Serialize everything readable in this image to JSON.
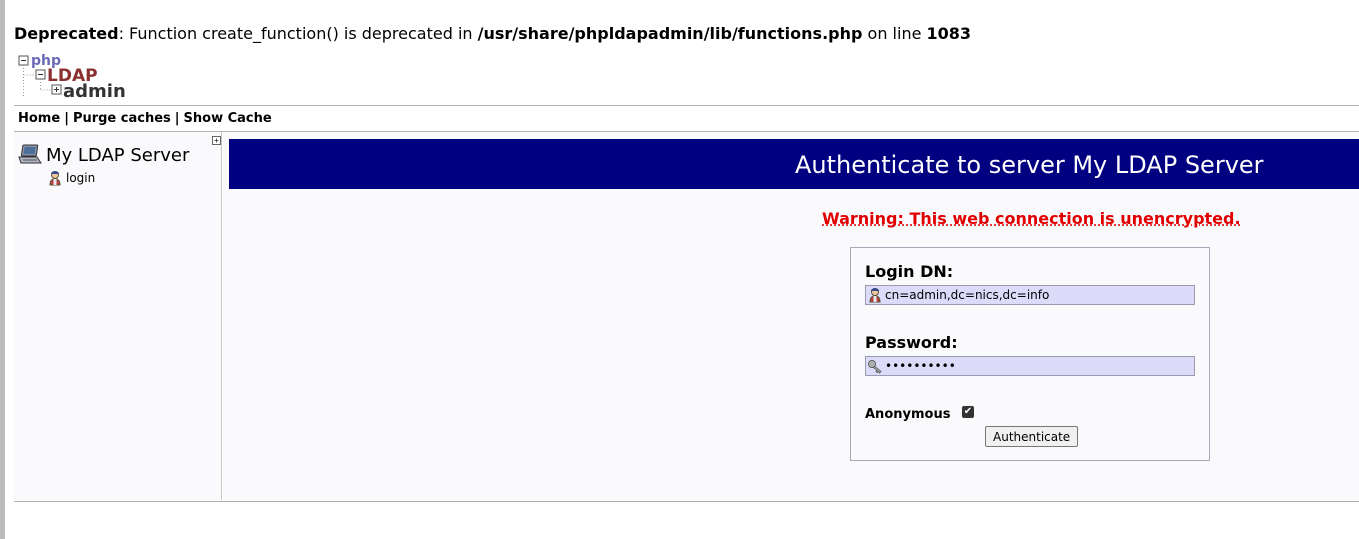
{
  "deprecation": {
    "prefix": "Deprecated",
    "message": ": Function create_function() is deprecated in ",
    "path": "/usr/share/phpldapadmin/lib/functions.php",
    "line_label": " on line ",
    "line_number": "1083"
  },
  "logo": {
    "php": "php",
    "ldap": "LDAP",
    "admin": "admin"
  },
  "menu": {
    "home": "Home",
    "purge": "Purge caches",
    "show_cache": "Show Cache",
    "separator": "|"
  },
  "tree": {
    "server_name": "My LDAP Server",
    "login_label": "login"
  },
  "main": {
    "title": "Authenticate to server My LDAP Server",
    "warning": "Warning: This web connection is unencrypted.",
    "login_dn_label": "Login DN:",
    "login_dn_value": "cn=admin,dc=nics,dc=info",
    "password_label": "Password:",
    "password_value": "••••••••••",
    "anonymous_label": "Anonymous",
    "anonymous_checked": true,
    "authenticate_label": "Authenticate"
  },
  "colors": {
    "title_bar": "#000080",
    "warning": "#e00000",
    "field_bg": "#dcdcfa"
  }
}
